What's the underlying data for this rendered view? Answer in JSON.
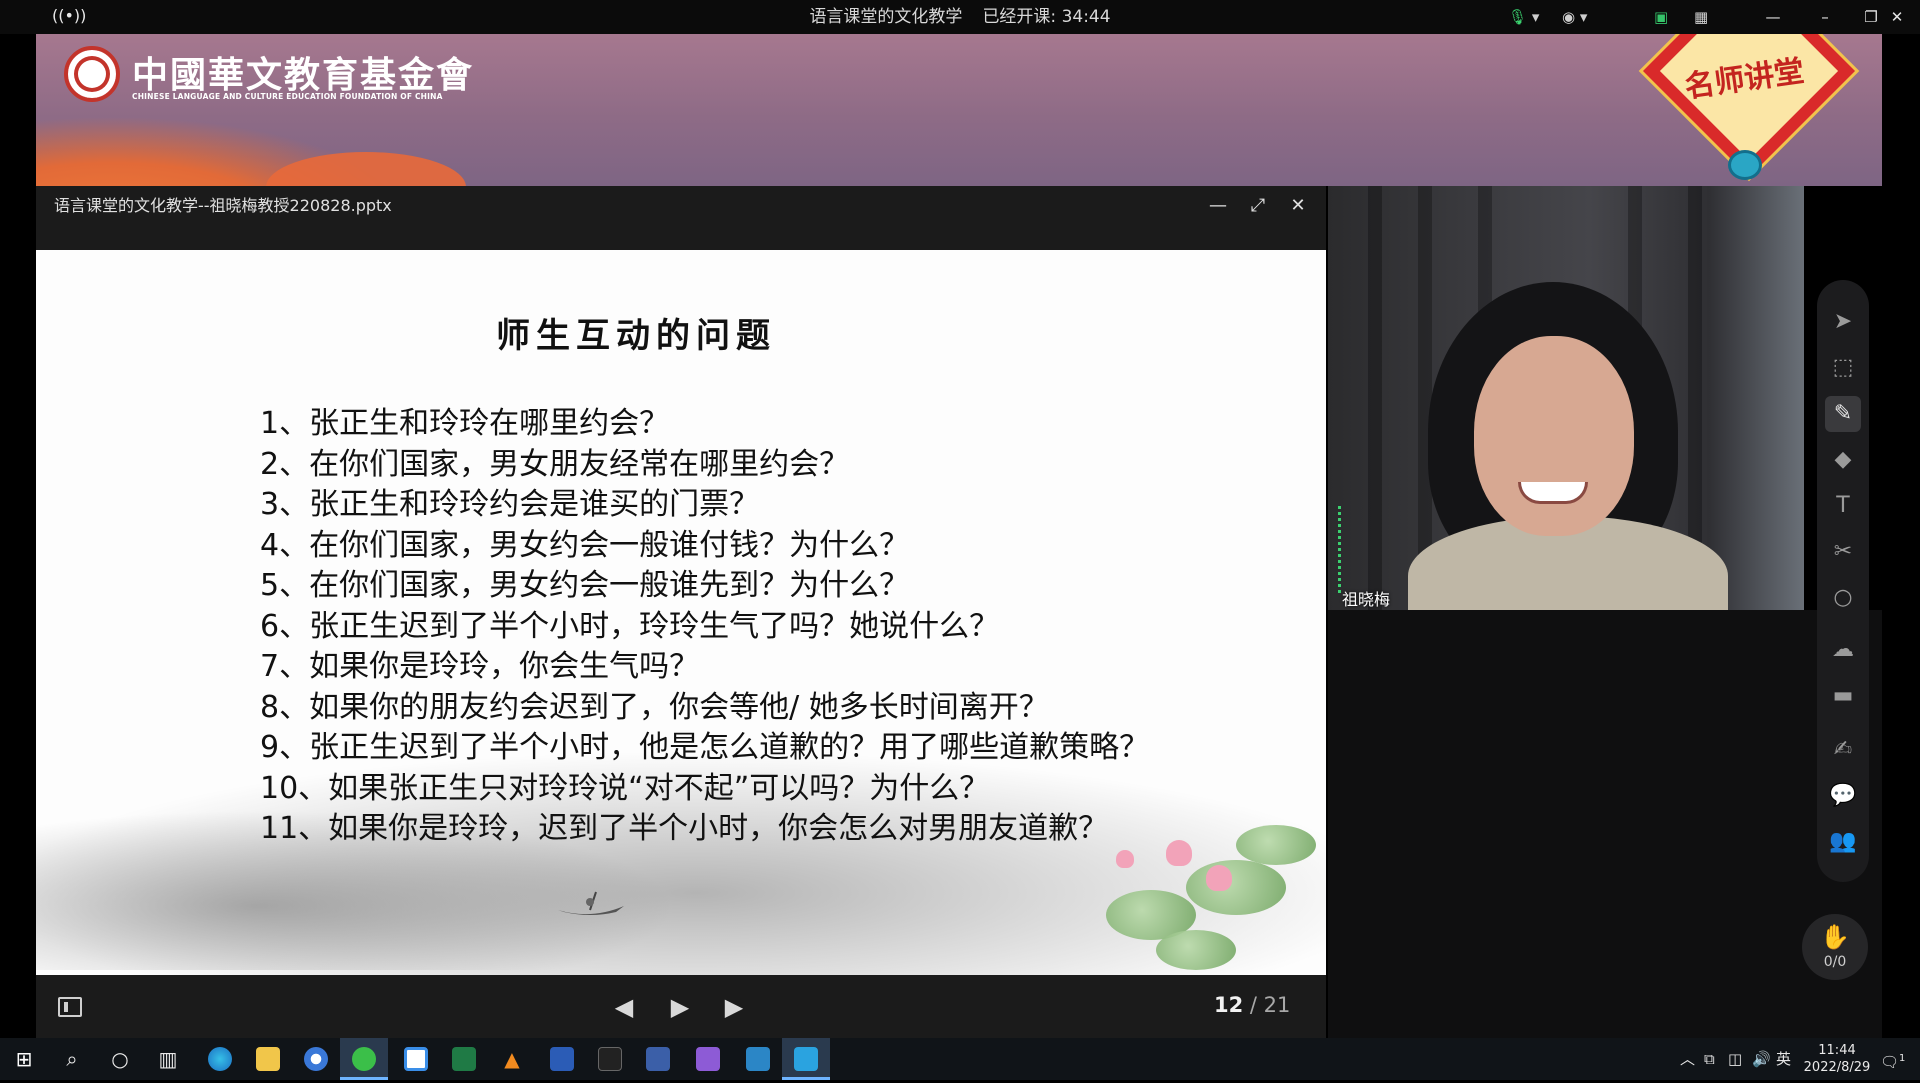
{
  "topbar": {
    "meeting_title": "语言课堂的文化教学",
    "elapsed_label": "已经开课: 34:44"
  },
  "banner": {
    "org_name_cn": "中國華文教育基金會",
    "org_name_en": "CHINESE LANGUAGE AND CULTURE EDUCATION FOUNDATION OF CHINA",
    "badge_text": "名师讲堂"
  },
  "slide_window": {
    "file_name": "语言课堂的文化教学--祖晓梅教授220828.pptx"
  },
  "slide": {
    "heading": "师生互动的问题",
    "questions": [
      "1、张正生和玲玲在哪里约会？",
      "2、在你们国家，男女朋友经常在哪里约会？",
      "3、张正生和玲玲约会是谁买的门票？",
      "4、在你们国家，男女约会一般谁付钱？为什么？",
      "5、在你们国家，男女约会一般谁先到？为什么？",
      "6、张正生迟到了半个小时，玲玲生气了吗？她说什么？",
      "7、如果你是玲玲，你会生气吗？",
      "8、如果你的朋友约会迟到了，你会等他/ 她多长时间离开？",
      "9、张正生迟到了半个小时，他是怎么道歉的？用了哪些道歉策略？",
      "10、如果张正生只对玲玲说“对不起”可以吗？为什么？",
      "11、如果你是玲玲，迟到了半个小时，你会怎么对男朋友道歉？"
    ]
  },
  "pager": {
    "current": "12",
    "separator": " / ",
    "total": "21"
  },
  "video": {
    "participant_name": "祖晓梅"
  },
  "handraise": {
    "count": "0/0"
  },
  "taskbar": {
    "input_lang": "英",
    "time": "11:44",
    "date": "2022/8/29",
    "notification_count": "1"
  },
  "colors": {
    "banner_bg": "#8e6b86",
    "accent_orange": "#e8693a",
    "badge_red": "#d92a2a",
    "mic_green": "#3bd16f"
  }
}
